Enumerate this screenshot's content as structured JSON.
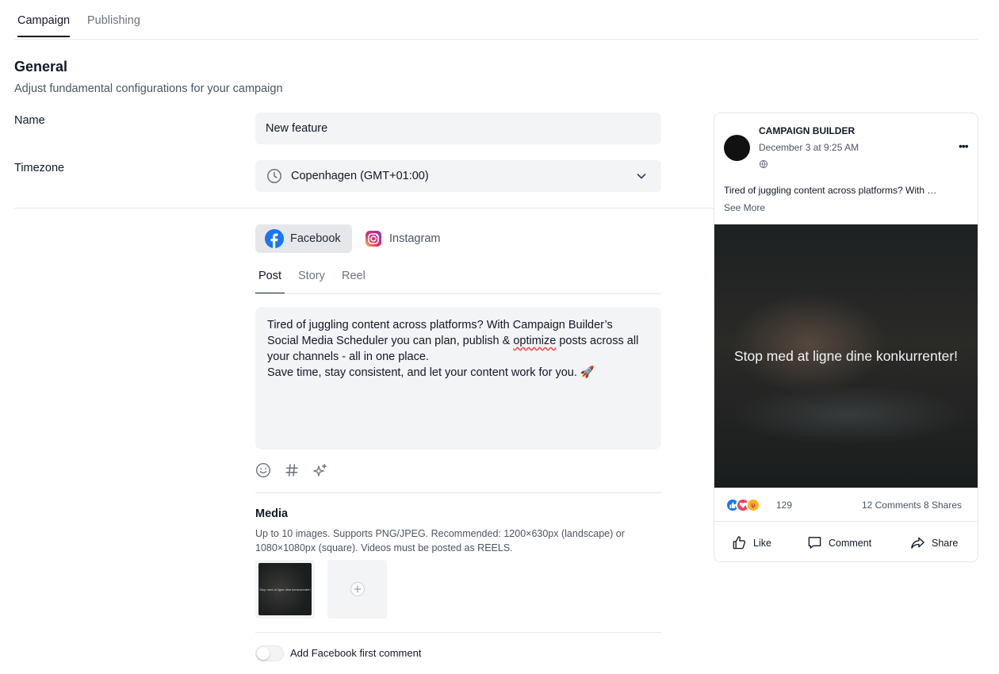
{
  "tabs": [
    {
      "label": "Campaign",
      "active": true
    },
    {
      "label": "Publishing",
      "active": false
    }
  ],
  "general": {
    "title": "General",
    "subtitle": "Adjust fundamental configurations for your campaign"
  },
  "name_field": {
    "label": "Name",
    "value": "New feature"
  },
  "timezone_field": {
    "label": "Timezone",
    "value": "Copenhagen (GMT+01:00)"
  },
  "platforms": [
    {
      "label": "Facebook",
      "active": true
    },
    {
      "label": "Instagram",
      "active": false
    }
  ],
  "post_types": [
    {
      "label": "Post",
      "active": true
    },
    {
      "label": "Story",
      "active": false
    },
    {
      "label": "Reel",
      "active": false
    }
  ],
  "editor": {
    "line1": "Tired of juggling content across platforms? With Campaign Builder’s",
    "line2_pre": "Social Media Scheduler you can plan, publish & ",
    "line2_flag": "optimize",
    "line2_post": " posts across all",
    "line3": "your channels - all in one place.",
    "line4": "Save time, stay consistent, and let your content work for you. 🚀"
  },
  "toolbar_icons": [
    "emoji-icon",
    "hashtag-icon",
    "ai-sparkle-icon"
  ],
  "media": {
    "title": "Media",
    "description": "Up to 10 images. Supports PNG/JPEG. Recommended: 1200×630px (landscape) or 1080×1080px (square). Videos must be posted as REELS.",
    "thumbnail_caption": "Stop med at ligne dine konkurrenter!"
  },
  "first_comment": {
    "label": "Add Facebook first comment",
    "enabled": false
  },
  "preview": {
    "page_name": "CAMPAIGN BUILDER",
    "date": "December 3 at 9:25 AM",
    "text": "Tired of juggling content across platforms? With …",
    "see_more": "See More",
    "image_text": "Stop med at ligne dine konkurrenter!",
    "reaction_count": "129",
    "stats": "12 Comments 8 Shares",
    "actions": {
      "like": "Like",
      "comment": "Comment",
      "share": "Share"
    }
  },
  "colors": {
    "facebook": "#1877f2",
    "like": "#1877f2",
    "love": "#f33e58",
    "care": "#f7b125",
    "field_bg": "#f3f4f6"
  }
}
